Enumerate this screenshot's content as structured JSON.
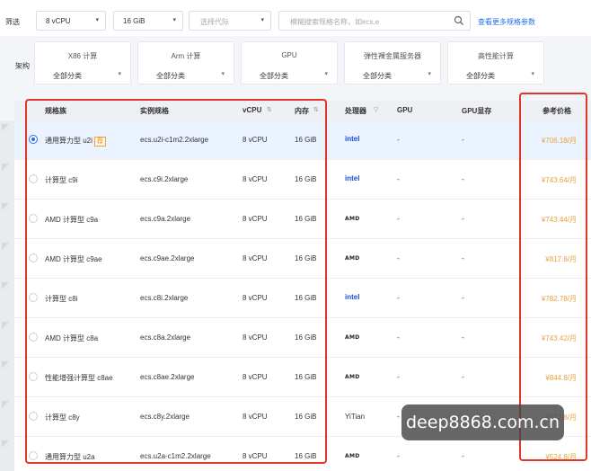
{
  "filter": {
    "label": "筛选",
    "cpu": "8 vCPU",
    "memory": "16 GiB",
    "generation_placeholder": "选择代际",
    "search_placeholder": "模糊搜索规格名称，如ecs.e",
    "more_link": "查看更多规格参数"
  },
  "arch": {
    "label": "架构",
    "cards": [
      {
        "name": "X86 计算",
        "sub": "全部分类"
      },
      {
        "name": "Arm 计算",
        "sub": "全部分类"
      },
      {
        "name": "GPU",
        "sub": "全部分类"
      },
      {
        "name": "弹性裸金属服务器",
        "sub": "全部分类"
      },
      {
        "name": "高性能计算",
        "sub": "全部分类"
      }
    ]
  },
  "table": {
    "headers": {
      "family": "规格族",
      "spec": "实例规格",
      "vcpu": "vCPU",
      "memory": "内存",
      "processor": "处理器",
      "gpu": "GPU",
      "gpu_mem": "GPU显存",
      "price": "参考价格"
    },
    "rows": [
      {
        "family": "通用算力型 u2i",
        "badge": "荐",
        "spec": "ecs.u2i-c1m2.2xlarge",
        "vcpu": "8 vCPU",
        "memory": "16 GiB",
        "processor": "intel",
        "gpu": "-",
        "gpu_mem": "-",
        "price": "¥706.18/月",
        "selected": true
      },
      {
        "family": "计算型 c9i",
        "spec": "ecs.c9i.2xlarge",
        "vcpu": "8 vCPU",
        "memory": "16 GiB",
        "processor": "intel",
        "gpu": "-",
        "gpu_mem": "-",
        "price": "¥743.64/月"
      },
      {
        "family": "AMD 计算型 c9a",
        "spec": "ecs.c9a.2xlarge",
        "vcpu": "8 vCPU",
        "memory": "16 GiB",
        "processor": "AMD",
        "gpu": "-",
        "gpu_mem": "-",
        "price": "¥743.44/月"
      },
      {
        "family": "AMD 计算型 c9ae",
        "spec": "ecs.c9ae.2xlarge",
        "vcpu": "8 vCPU",
        "memory": "16 GiB",
        "processor": "AMD",
        "gpu": "-",
        "gpu_mem": "-",
        "price": "¥817.8/月"
      },
      {
        "family": "计算型 c8i",
        "spec": "ecs.c8i.2xlarge",
        "vcpu": "8 vCPU",
        "memory": "16 GiB",
        "processor": "intel",
        "gpu": "-",
        "gpu_mem": "-",
        "price": "¥782.78/月"
      },
      {
        "family": "AMD 计算型 c8a",
        "spec": "ecs.c8a.2xlarge",
        "vcpu": "8 vCPU",
        "memory": "16 GiB",
        "processor": "AMD",
        "gpu": "-",
        "gpu_mem": "-",
        "price": "¥743.42/月"
      },
      {
        "family": "性能增强计算型 c8ae",
        "spec": "ecs.c8ae.2xlarge",
        "vcpu": "8 vCPU",
        "memory": "16 GiB",
        "processor": "AMD",
        "gpu": "-",
        "gpu_mem": "-",
        "price": "¥844.8/月"
      },
      {
        "family": "计算型 c8y",
        "spec": "ecs.c8y.2xlarge",
        "vcpu": "8 vCPU",
        "memory": "16 GiB",
        "processor": "YiTian",
        "gpu": "-",
        "gpu_mem": "-",
        "price": "¥512.8/月"
      },
      {
        "family": "通用算力型 u2a",
        "spec": "ecs.u2a-c1m2.2xlarge",
        "vcpu": "8 vCPU",
        "memory": "16 GiB",
        "processor": "AMD",
        "gpu": "-",
        "gpu_mem": "-",
        "price": "¥524.8/月"
      }
    ]
  },
  "watermark": "deep8868.com.cn",
  "colors": {
    "highlight": "#e2362b",
    "price": "#e8a33c",
    "link": "#1f6feb",
    "intel": "#1b4fd1",
    "selected_row": "#eaf3ff"
  }
}
